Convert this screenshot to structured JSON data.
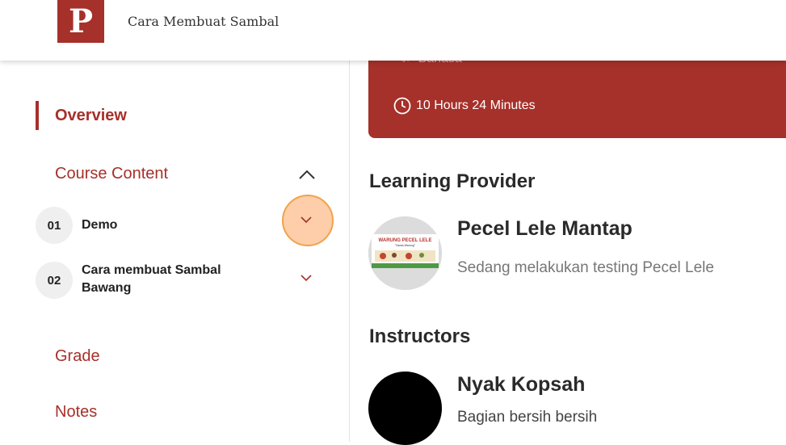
{
  "header": {
    "logo_letter": "P",
    "title": "Cara Membuat Sambal"
  },
  "sidebar": {
    "overview": "Overview",
    "course_content": "Course Content",
    "modules": [
      {
        "number": "01",
        "title": "Demo"
      },
      {
        "number": "02",
        "title_line1": "Cara membuat Sambal",
        "title_line2": "Bawang"
      }
    ],
    "grade": "Grade",
    "notes": "Notes"
  },
  "banner": {
    "partial_text": "Bahasa",
    "duration": "10 Hours 24 Minutes"
  },
  "provider": {
    "section_title": "Learning Provider",
    "name": "Pecel Lele Mantap",
    "description": "Sedang melakukan testing Pecel Lele",
    "logo_text": "WARUNG PECEL LELE",
    "logo_subtext": "\"Nama Warung\""
  },
  "instructors": {
    "section_title": "Instructors",
    "name": "Nyak Kopsah",
    "description": "Bagian bersih bersih"
  },
  "colors": {
    "brand": "#a6302a",
    "highlight": "#f1a24a"
  }
}
